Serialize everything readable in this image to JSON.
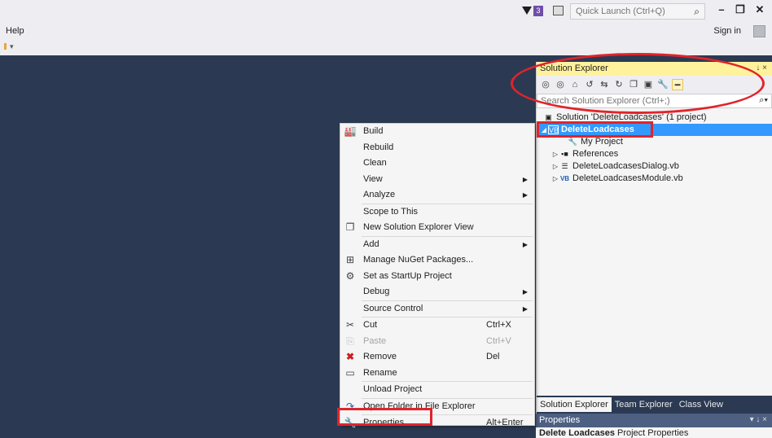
{
  "titlebar": {
    "notification_count": "3",
    "quick_launch_placeholder": "Quick Launch (Ctrl+Q)",
    "sign_in": "Sign in"
  },
  "menubar": {
    "help": "Help"
  },
  "solution_explorer": {
    "title": "Solution Explorer",
    "title_buttons": "↓ ×",
    "search_placeholder": "Search Solution Explorer (Ctrl+;)",
    "tree": [
      {
        "label": "Solution 'DeleteLoadcases' (1 project)"
      },
      {
        "label": "DeleteLoadcases"
      },
      {
        "label": "My Project"
      },
      {
        "label": "References"
      },
      {
        "label": "DeleteLoadcasesDialog.vb"
      },
      {
        "label": "DeleteLoadcasesModule.vb"
      }
    ],
    "tabs": [
      "Solution Explorer",
      "Team Explorer",
      "Class View"
    ]
  },
  "properties": {
    "title": "Properties",
    "title_buttons": "▾ ↓ ×",
    "object": "Delete Loadcases",
    "object_type": "Project Properties"
  },
  "context_menu": {
    "items": [
      {
        "label": "Build",
        "icon": "build-icon"
      },
      {
        "label": "Rebuild"
      },
      {
        "label": "Clean"
      },
      {
        "label": "View",
        "submenu": true
      },
      {
        "label": "Analyze",
        "submenu": true
      },
      {
        "label": "Scope to This"
      },
      {
        "label": "New Solution Explorer View",
        "icon": "new-view-icon"
      },
      {
        "label": "Add",
        "submenu": true
      },
      {
        "label": "Manage NuGet Packages...",
        "icon": "nuget-icon"
      },
      {
        "label": "Set as StartUp Project",
        "icon": "gear-icon"
      },
      {
        "label": "Debug",
        "submenu": true
      },
      {
        "label": "Source Control",
        "submenu": true
      },
      {
        "label": "Cut",
        "shortcut": "Ctrl+X",
        "icon": "scissors-icon"
      },
      {
        "label": "Paste",
        "shortcut": "Ctrl+V",
        "icon": "paste-icon",
        "disabled": true
      },
      {
        "label": "Remove",
        "shortcut": "Del",
        "icon": "delete-icon"
      },
      {
        "label": "Rename",
        "icon": "rename-icon"
      },
      {
        "label": "Unload Project"
      },
      {
        "label": "Open Folder in File Explorer",
        "icon": "refresh-folder-icon"
      },
      {
        "label": "Properties",
        "shortcut": "Alt+Enter",
        "icon": "wrench-icon"
      }
    ]
  },
  "colors": {
    "background": "#2b3a52",
    "selection": "#3399ff",
    "highlight_annotation": "#e0242b",
    "se_title": "#fff29d"
  }
}
